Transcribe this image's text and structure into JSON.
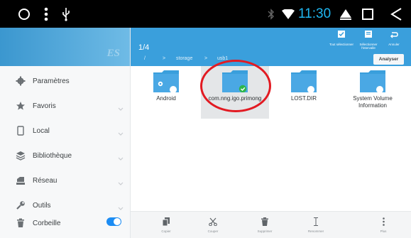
{
  "status_bar": {
    "time": "11:30",
    "icons": [
      "circle-icon",
      "menu-dots-icon",
      "usb-icon",
      "bluetooth-icon",
      "wifi-icon",
      "home-icon",
      "recents-icon",
      "back-icon"
    ]
  },
  "sidebar": {
    "logo": "ES",
    "items": [
      {
        "label": "Paramètres",
        "icon": "gear-icon"
      },
      {
        "label": "Favoris",
        "icon": "star-icon"
      },
      {
        "label": "Local",
        "icon": "phone-icon"
      },
      {
        "label": "Bibliothèque",
        "icon": "library-icon"
      },
      {
        "label": "Réseau",
        "icon": "network-icon"
      },
      {
        "label": "Outils",
        "icon": "wrench-icon"
      },
      {
        "label": "Corbeille",
        "icon": "trash-icon"
      }
    ]
  },
  "main": {
    "counter": "1/4",
    "header_buttons": {
      "select_all": "Tout sélectionner",
      "select_range": "Sélectionner l'intervalle",
      "cancel": "Annuler"
    },
    "breadcrumb": [
      "/",
      "storage",
      "usb1"
    ],
    "analyze_label": "Analyser",
    "files": [
      {
        "name": "Android",
        "selected": false
      },
      {
        "name": "com.nng.igo.primong",
        "selected": true
      },
      {
        "name": "LOST.DIR",
        "selected": false
      },
      {
        "name": "System Volume Information",
        "selected": false
      }
    ]
  },
  "bottom_bar": {
    "copy": "Copier",
    "cut": "Couper",
    "delete": "Supprimer",
    "rename": "Renommer",
    "more": "Plus"
  },
  "colors": {
    "accent": "#3a9fdc",
    "annotation": "#e21a22",
    "toggle_on": "#1c8cf3",
    "time": "#1fb6f0"
  }
}
